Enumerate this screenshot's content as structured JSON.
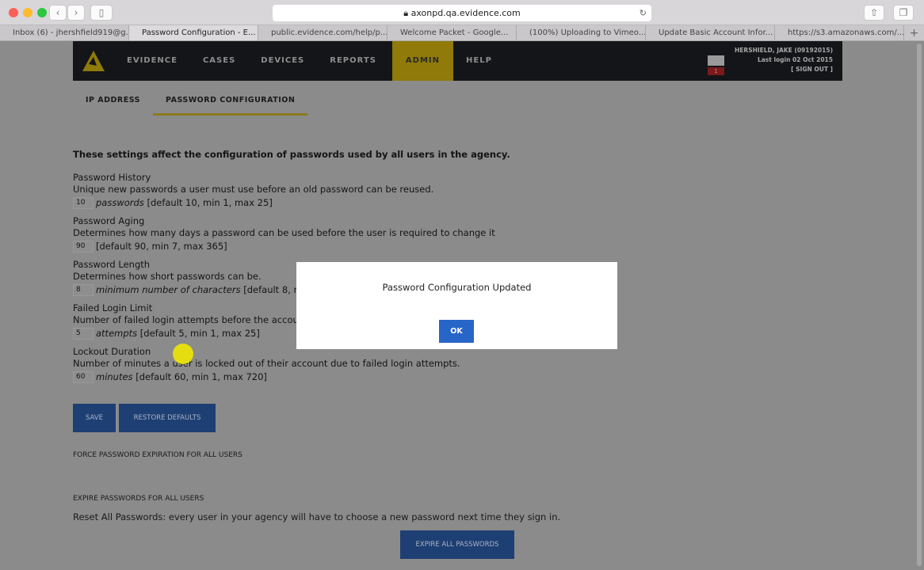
{
  "browser": {
    "url": "axonpd.qa.evidence.com",
    "tabs": [
      "Inbox (6) - jhershfield919@g...",
      "Password Configuration - E...",
      "public.evidence.com/help/p...",
      "Welcome Packet - Google...",
      "(100%) Uploading to Vimeo...",
      "Update Basic Account Infor...",
      "https://s3.amazonaws.com/..."
    ],
    "new_tab": "+"
  },
  "nav": {
    "items": [
      "EVIDENCE",
      "CASES",
      "DEVICES",
      "REPORTS",
      "ADMIN",
      "HELP"
    ],
    "user": "HERSHIELD, JAKE (09192015)",
    "last_login": "Last login 02 Oct 2015",
    "sign_out": "[ SIGN OUT ]",
    "mail_count": "1"
  },
  "subtabs": [
    "IP ADDRESS",
    "PASSWORD CONFIGURATION"
  ],
  "intro": "These settings affect the configuration of passwords used by all users in the agency.",
  "settings": [
    {
      "title": "Password History",
      "desc": "Unique new passwords a user must use before an old password can be reused.",
      "value": "10",
      "unit": "passwords",
      "hint": " [default 10, min 1, max 25]"
    },
    {
      "title": "Password Aging",
      "desc": "Determines how many days a password can be used before the user is required to change it",
      "value": "90",
      "unit": "",
      "hint": "[default 90, min 7, max 365]"
    },
    {
      "title": "Password Length",
      "desc": "Determines how short passwords can be.",
      "value": "8",
      "unit": "minimum number of characters",
      "hint": " [default 8, min"
    },
    {
      "title": "Failed Login Limit",
      "desc": "Number of failed login attempts before the accoun",
      "value": "5",
      "unit": "attempts",
      "hint": " [default 5, min 1, max 25]"
    },
    {
      "title": "Lockout Duration",
      "desc": "Number of minutes a user is locked out of their account due to failed login attempts.",
      "value": "60",
      "unit": "minutes",
      "hint": " [default 60, min 1, max 720]"
    }
  ],
  "buttons": {
    "save": "SAVE",
    "restore": "RESTORE DEFAULTS",
    "expire_all": "EXPIRE ALL PASSWORDS"
  },
  "force_heading": "FORCE PASSWORD EXPIRATION FOR ALL USERS",
  "expire_heading": "EXPIRE PASSWORDS FOR ALL USERS",
  "expire_desc": "Reset All Passwords: every user in your agency will have to choose a new password next time they sign in.",
  "modal": {
    "title": "Password Configuration Updated",
    "ok": "OK"
  }
}
